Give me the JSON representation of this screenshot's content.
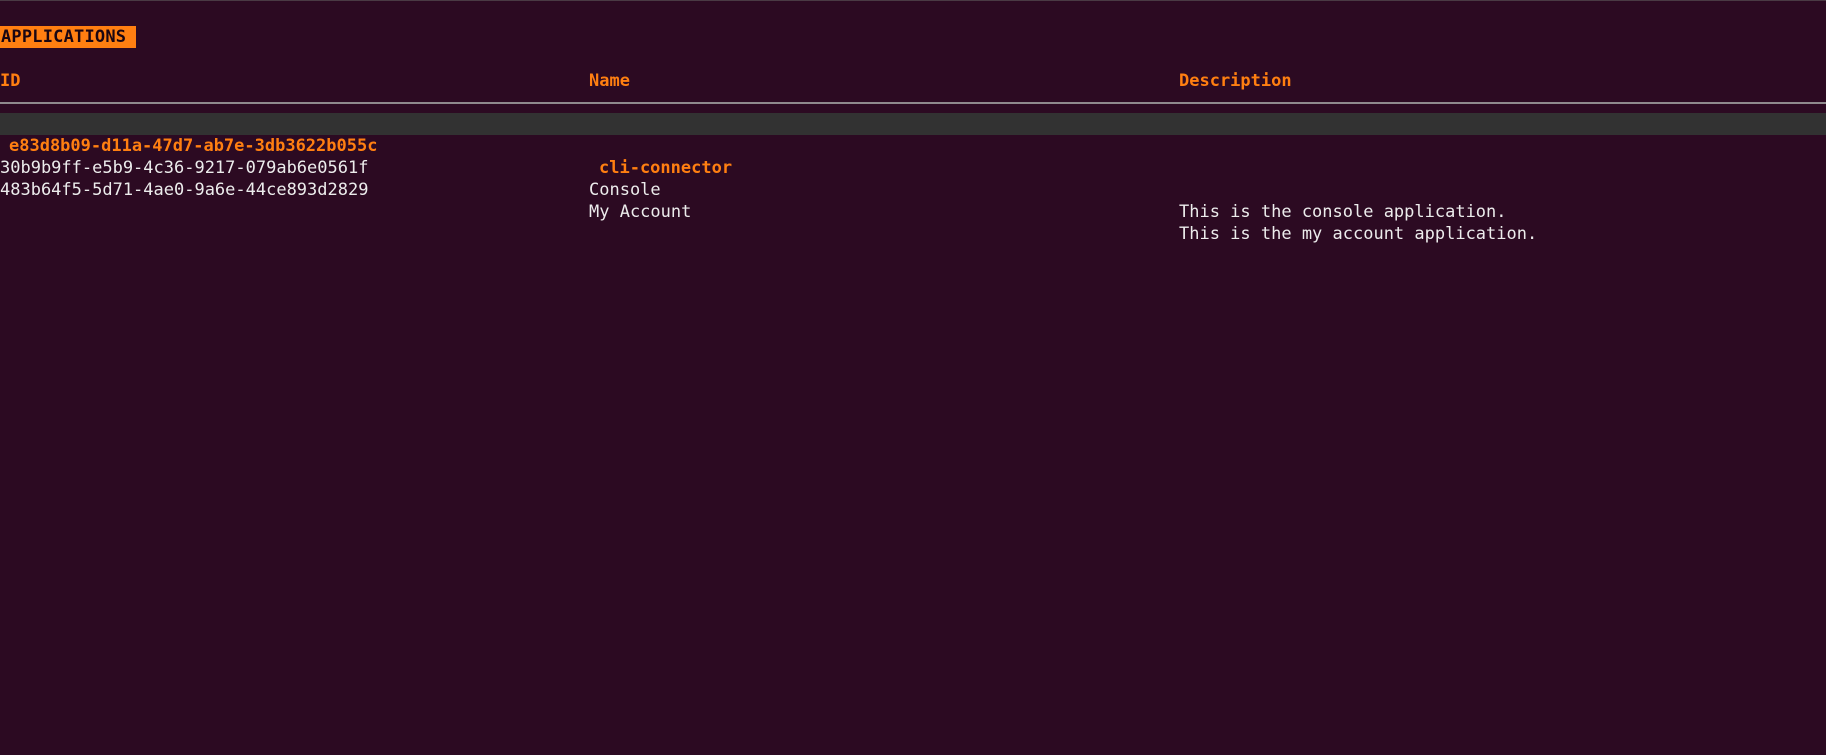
{
  "panel": {
    "title": "APPLICATIONS"
  },
  "table": {
    "columns": {
      "id": "ID",
      "name": "Name",
      "description": "Description"
    },
    "rows": [
      {
        "id": "e83d8b09-d11a-47d7-ab7e-3db3622b055c",
        "name": "cli-connector",
        "description": "",
        "selected": true
      },
      {
        "id": "30b9b9ff-e5b9-4c36-9217-079ab6e0561f",
        "name": "Console",
        "description": "This is the console application.",
        "selected": false
      },
      {
        "id": "483b64f5-5d71-4ae0-9a6e-44ce893d2829",
        "name": "My Account",
        "description": "This is the my account application.",
        "selected": false
      }
    ]
  },
  "colors": {
    "background": "#2c0a22",
    "accent": "#ff7f11",
    "selected_row_bg": "#323232",
    "text": "#ececec"
  }
}
